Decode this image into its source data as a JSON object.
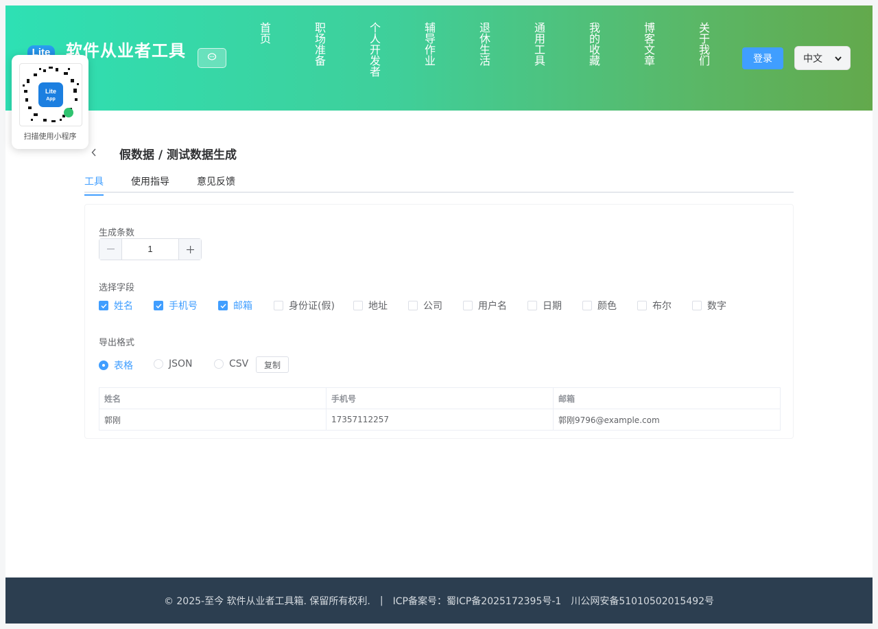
{
  "header": {
    "logo_text": "Lite",
    "title": "软件从业者工具",
    "nav": [
      "首页",
      "职场准备",
      "个人开发者",
      "辅导作业",
      "退休生活",
      "通用工具",
      "我的收藏",
      "博客文章",
      "关于我们"
    ],
    "login_label": "登录",
    "language": "中文"
  },
  "qr_popup": {
    "logo_line1": "Lite",
    "logo_line2": "App",
    "caption": "扫描使用小程序"
  },
  "page": {
    "title": "假数据 / 测试数据生成",
    "tabs": [
      "工具",
      "使用指导",
      "意见反馈"
    ],
    "active_tab": "工具"
  },
  "form": {
    "count_label": "生成条数",
    "count_value": "1",
    "fields_label": "选择字段",
    "fields": [
      {
        "label": "姓名",
        "checked": true
      },
      {
        "label": "手机号",
        "checked": true
      },
      {
        "label": "邮箱",
        "checked": true
      },
      {
        "label": "身份证(假)",
        "checked": false
      },
      {
        "label": "地址",
        "checked": false
      },
      {
        "label": "公司",
        "checked": false
      },
      {
        "label": "用户名",
        "checked": false
      },
      {
        "label": "日期",
        "checked": false
      },
      {
        "label": "颜色",
        "checked": false
      },
      {
        "label": "布尔",
        "checked": false
      },
      {
        "label": "数字",
        "checked": false
      }
    ],
    "format_label": "导出格式",
    "formats": [
      {
        "label": "表格",
        "selected": true
      },
      {
        "label": "JSON",
        "selected": false
      },
      {
        "label": "CSV",
        "selected": false
      }
    ],
    "copy_label": "复制"
  },
  "result": {
    "columns": [
      "姓名",
      "手机号",
      "邮箱"
    ],
    "rows": [
      [
        "郭刚",
        "17357112257",
        "郭刚9796@example.com"
      ]
    ]
  },
  "footer": {
    "copyright": "© 2025-至今 软件从业者工具箱. 保留所有权利.",
    "separator": "|",
    "icp": "ICP备案号：蜀ICP备2025172395号-1",
    "police": "川公网安备51010502015492号"
  },
  "colors": {
    "accent": "#409eff",
    "footer_bg": "#2c3e50",
    "header_gradient_start": "#2ee0b4",
    "header_gradient_end": "#63a94c"
  }
}
